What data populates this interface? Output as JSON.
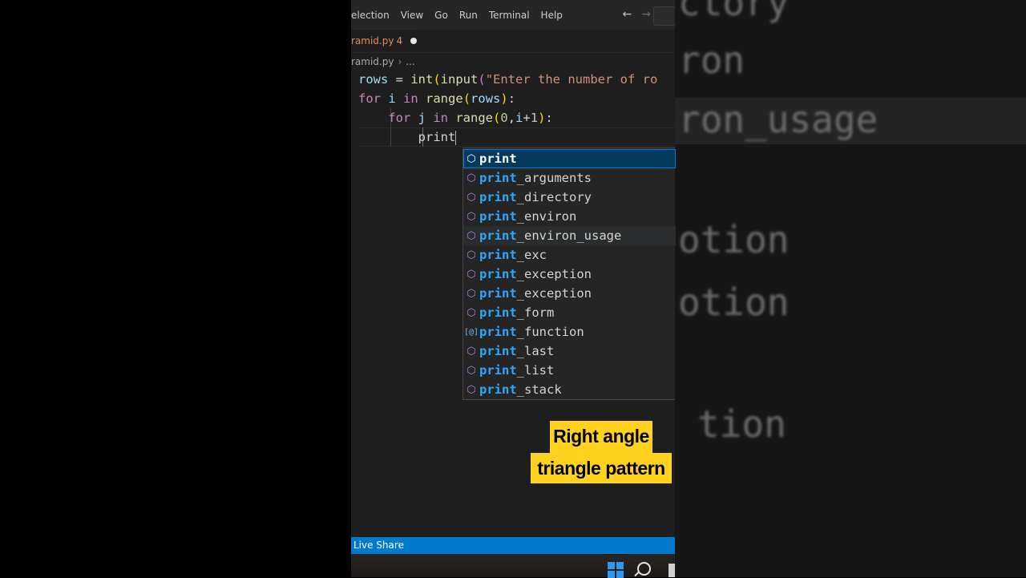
{
  "menu": [
    "election",
    "View",
    "Go",
    "Run",
    "Terminal",
    "Help"
  ],
  "tab": {
    "title": "ramid.py",
    "errors": "4"
  },
  "breadcrumb": {
    "file": "ramid.py",
    "more": "..."
  },
  "code": {
    "line1": {
      "var": "rows",
      "op": " = ",
      "fn1": "int",
      "fn2": "input",
      "str": "\"Enter the number of ro"
    },
    "line2": {
      "kw1": "for",
      "var": " i ",
      "kw2": "in",
      "fn": "range",
      "arg": "rows",
      "end": ":"
    },
    "line3": {
      "kw1": "for",
      "var": " j ",
      "kw2": "in",
      "fn": "range",
      "n0": "0",
      "comma": ",",
      "i": "i",
      "plus": "+",
      "n1": "1",
      "end": ":"
    },
    "line4": {
      "text": "print"
    }
  },
  "suggestions": [
    {
      "match": "print",
      "rest": "",
      "icon": "cube-icon"
    },
    {
      "match": "print",
      "rest": "_arguments",
      "icon": "cube-icon"
    },
    {
      "match": "print",
      "rest": "_directory",
      "icon": "cube-icon"
    },
    {
      "match": "print",
      "rest": "_environ",
      "icon": "cube-icon"
    },
    {
      "match": "print",
      "rest": "_environ_usage",
      "icon": "cube-icon"
    },
    {
      "match": "print",
      "rest": "_exc",
      "icon": "cube-icon"
    },
    {
      "match": "print",
      "rest": "_exception",
      "icon": "cube-icon"
    },
    {
      "match": "print",
      "rest": "_exception",
      "icon": "cube-icon"
    },
    {
      "match": "print",
      "rest": "_form",
      "icon": "cube-icon"
    },
    {
      "match": "print",
      "rest": "_function",
      "icon": "variable-icon"
    },
    {
      "match": "print",
      "rest": "_last",
      "icon": "cube-icon"
    },
    {
      "match": "print",
      "rest": "_list",
      "icon": "cube-icon"
    },
    {
      "match": "print",
      "rest": "_stack",
      "icon": "cube-icon"
    }
  ],
  "caption": {
    "line1": "Right angle",
    "line2": "triangle pattern"
  },
  "status": {
    "live_share": "Live Share"
  },
  "background_words": [
    "ctory",
    "ron",
    "ron_usage",
    "otion",
    "otion",
    "tion"
  ],
  "colors": {
    "accent": "#007acc",
    "caption_bg": "#ffd21f"
  }
}
